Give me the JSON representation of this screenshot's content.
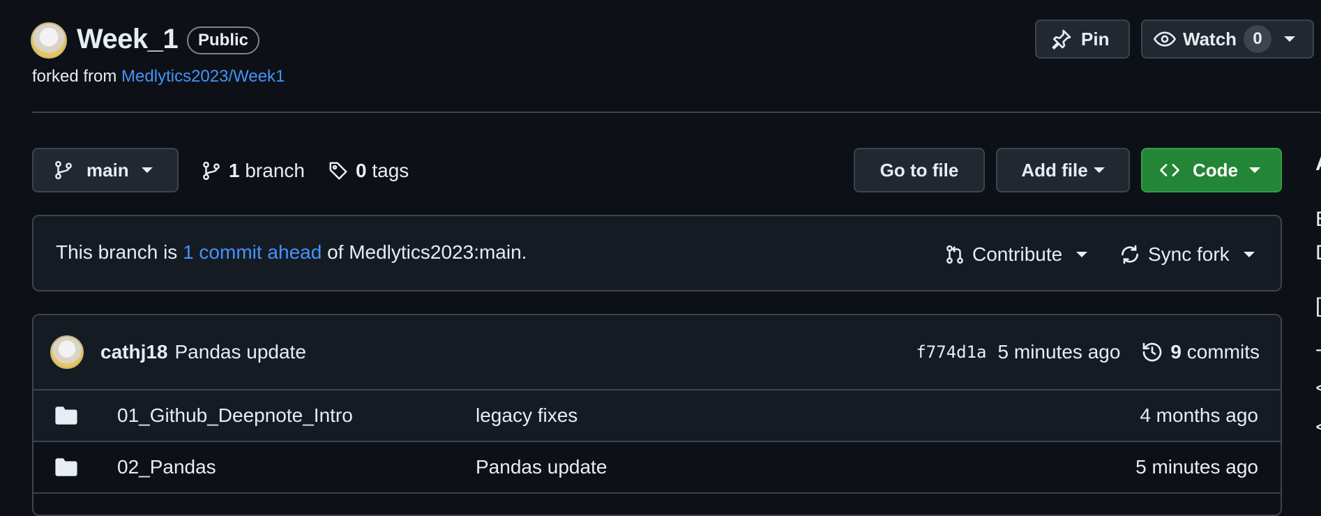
{
  "repo": {
    "name": "Week_1",
    "visibility": "Public",
    "forked_prefix": "forked from",
    "forked_source": "Medlytics2023/Week1"
  },
  "header_actions": {
    "pin_label": "Pin",
    "watch_label": "Watch",
    "watch_count": "0"
  },
  "branch_bar": {
    "current_branch": "main",
    "branches_count": "1",
    "branches_label": "branch",
    "tags_count": "0",
    "tags_label": "tags",
    "go_to_file": "Go to file",
    "add_file": "Add file",
    "code": "Code"
  },
  "ahead_banner": {
    "prefix": "This branch is",
    "link": "1 commit ahead",
    "suffix": "of Medlytics2023:main.",
    "contribute": "Contribute",
    "sync_fork": "Sync fork"
  },
  "latest_commit": {
    "author": "cathj18",
    "message": "Pandas update",
    "sha": "f774d1a",
    "time": "5 minutes ago",
    "commits_count": "9",
    "commits_label": "commits"
  },
  "files": [
    {
      "name": "01_Github_Deepnote_Intro",
      "message": "legacy fixes",
      "time": "4 months ago"
    },
    {
      "name": "02_Pandas",
      "message": "Pandas update",
      "time": "5 minutes ago"
    }
  ]
}
